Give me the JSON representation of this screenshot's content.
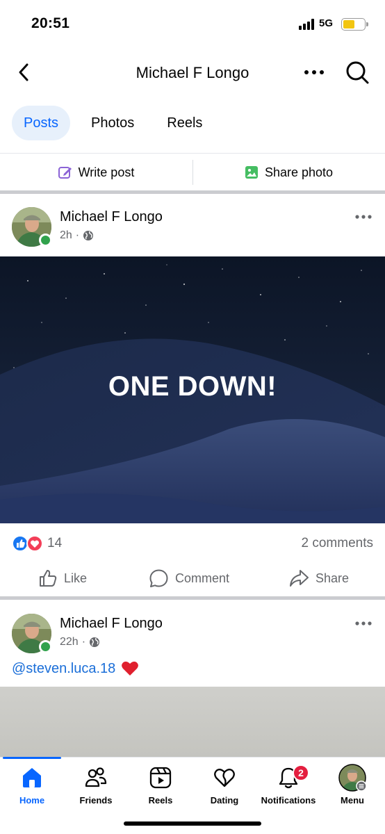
{
  "status_bar": {
    "time": "20:51",
    "network": "5G",
    "battery_color": "#f2c511"
  },
  "header": {
    "title": "Michael F Longo"
  },
  "tabs": [
    {
      "label": "Posts",
      "active": true
    },
    {
      "label": "Photos",
      "active": false
    },
    {
      "label": "Reels",
      "active": false
    }
  ],
  "composer": {
    "write_post": "Write post",
    "share_photo": "Share photo"
  },
  "posts": [
    {
      "author": "Michael F Longo",
      "time": "2h",
      "image_text": "ONE DOWN!",
      "reaction_count": "14",
      "comments": "2 comments",
      "actions": {
        "like": "Like",
        "comment": "Comment",
        "share": "Share"
      }
    },
    {
      "author": "Michael F Longo",
      "time": "22h",
      "caption": "@steven.luca.18"
    }
  ],
  "bottom_nav": [
    {
      "label": "Home",
      "icon": "home-icon",
      "active": true
    },
    {
      "label": "Friends",
      "icon": "friends-icon"
    },
    {
      "label": "Reels",
      "icon": "reels-icon"
    },
    {
      "label": "Dating",
      "icon": "dating-icon"
    },
    {
      "label": "Notifications",
      "icon": "bell-icon",
      "badge": "2"
    },
    {
      "label": "Menu",
      "icon": "avatar"
    }
  ],
  "colors": {
    "accent": "#0866ff",
    "online": "#31a24c",
    "badge": "#e41e3f",
    "like": "#1877f2",
    "love": "#f33e58"
  }
}
